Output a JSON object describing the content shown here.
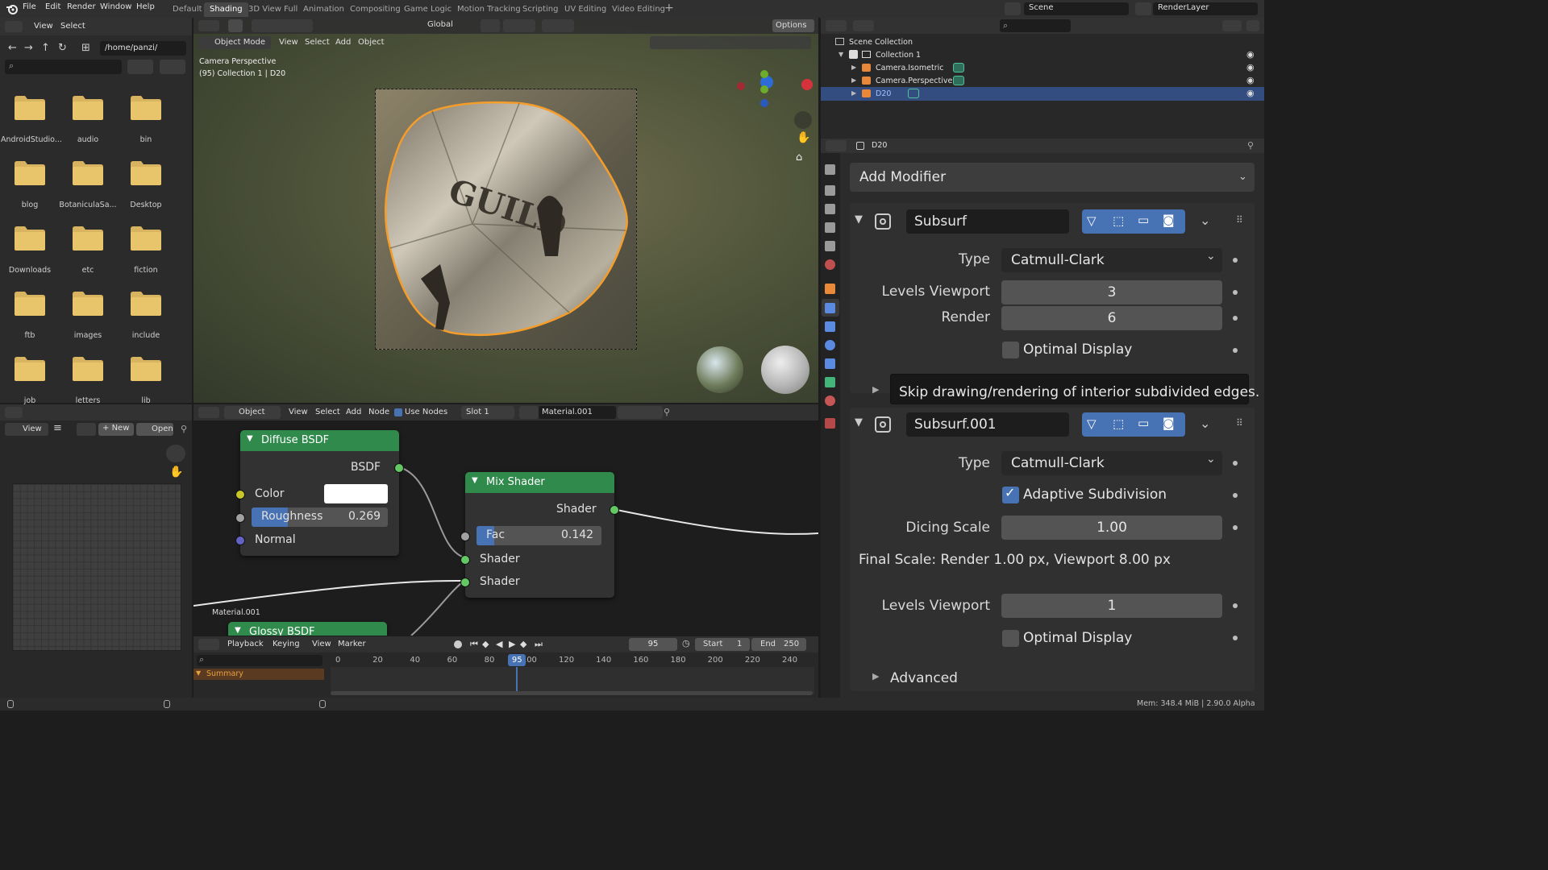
{
  "topbar": {
    "menus": [
      "File",
      "Edit",
      "Render",
      "Window",
      "Help"
    ],
    "workspaces": [
      "Default",
      "Shading",
      "3D View Full",
      "Animation",
      "Compositing",
      "Game Logic",
      "Motion Tracking",
      "Scripting",
      "UV Editing",
      "Video Editing"
    ],
    "active_workspace": "Shading",
    "scene": "Scene",
    "render_layer": "RenderLayer"
  },
  "filebrowser": {
    "menus": [
      "View",
      "Select"
    ],
    "path": "/home/panzi/",
    "folders": [
      "AndroidStudio...",
      "audio",
      "bin",
      "blog",
      "BotaniculaSa...",
      "Desktop",
      "Downloads",
      "etc",
      "fiction",
      "ftb",
      "images",
      "include",
      "job",
      "letters",
      "lib"
    ]
  },
  "viewport": {
    "mode": "Object Mode",
    "menus": [
      "View",
      "Select",
      "Add",
      "Object"
    ],
    "transform": "Global",
    "options": "Options",
    "camera_label": "Camera Perspective",
    "collection_label": "(95) Collection 1 | D20",
    "die_text": "GUILD"
  },
  "outliner": {
    "root": "Scene Collection",
    "collection": "Collection 1",
    "items": [
      "Camera.Isometric",
      "Camera.Perspective",
      "D20"
    ],
    "selected": "D20"
  },
  "properties": {
    "object_name": "D20",
    "add_modifier": "Add Modifier",
    "mod1": {
      "name": "Subsurf",
      "type_label": "Type",
      "type": "Catmull-Clark",
      "levels_viewport_label": "Levels Viewport",
      "levels_viewport": "3",
      "render_label": "Render",
      "render": "6",
      "optimal_display": "Optimal Display"
    },
    "tooltip": "Skip drawing/rendering of interior subdivided edges.",
    "mod2": {
      "name": "Subsurf.001",
      "type_label": "Type",
      "type": "Catmull-Clark",
      "adaptive": "Adaptive Subdivision",
      "dicing_label": "Dicing Scale",
      "dicing": "1.00",
      "final_scale": "Final Scale: Render 1.00 px, Viewport 8.00 px",
      "levels_viewport_label": "Levels Viewport",
      "levels_viewport": "1",
      "optimal_display": "Optimal Display",
      "advanced": "Advanced"
    }
  },
  "image_editor": {
    "view": "View",
    "new": "New",
    "open": "Open"
  },
  "node_editor": {
    "mode": "Object",
    "menus": [
      "View",
      "Select",
      "Add",
      "Node"
    ],
    "use_nodes": "Use Nodes",
    "slot": "Slot 1",
    "material": "Material.001",
    "frame_label": "Material.001",
    "diffuse": {
      "title": "Diffuse BSDF",
      "out": "BSDF",
      "color": "Color",
      "roughness_label": "Roughness",
      "roughness": "0.269",
      "roughness_fraction": 0.269,
      "normal": "Normal"
    },
    "mix": {
      "title": "Mix Shader",
      "out": "Shader",
      "fac_label": "Fac",
      "fac": "0.142",
      "fac_fraction": 0.142,
      "in1": "Shader",
      "in2": "Shader"
    },
    "glossy": {
      "title": "Glossy BSDF"
    }
  },
  "timeline": {
    "menus": [
      "Playback",
      "Keying",
      "View",
      "Marker"
    ],
    "current_frame": "95",
    "start_label": "Start",
    "start": "1",
    "end_label": "End",
    "end": "250",
    "ticks": [
      "0",
      "20",
      "40",
      "60",
      "80",
      "100",
      "120",
      "140",
      "160",
      "180",
      "200",
      "220",
      "240"
    ],
    "summary": "Summary"
  },
  "statusbar": {
    "info": "Mem: 348.4 MiB | 2.90.0 Alpha"
  }
}
